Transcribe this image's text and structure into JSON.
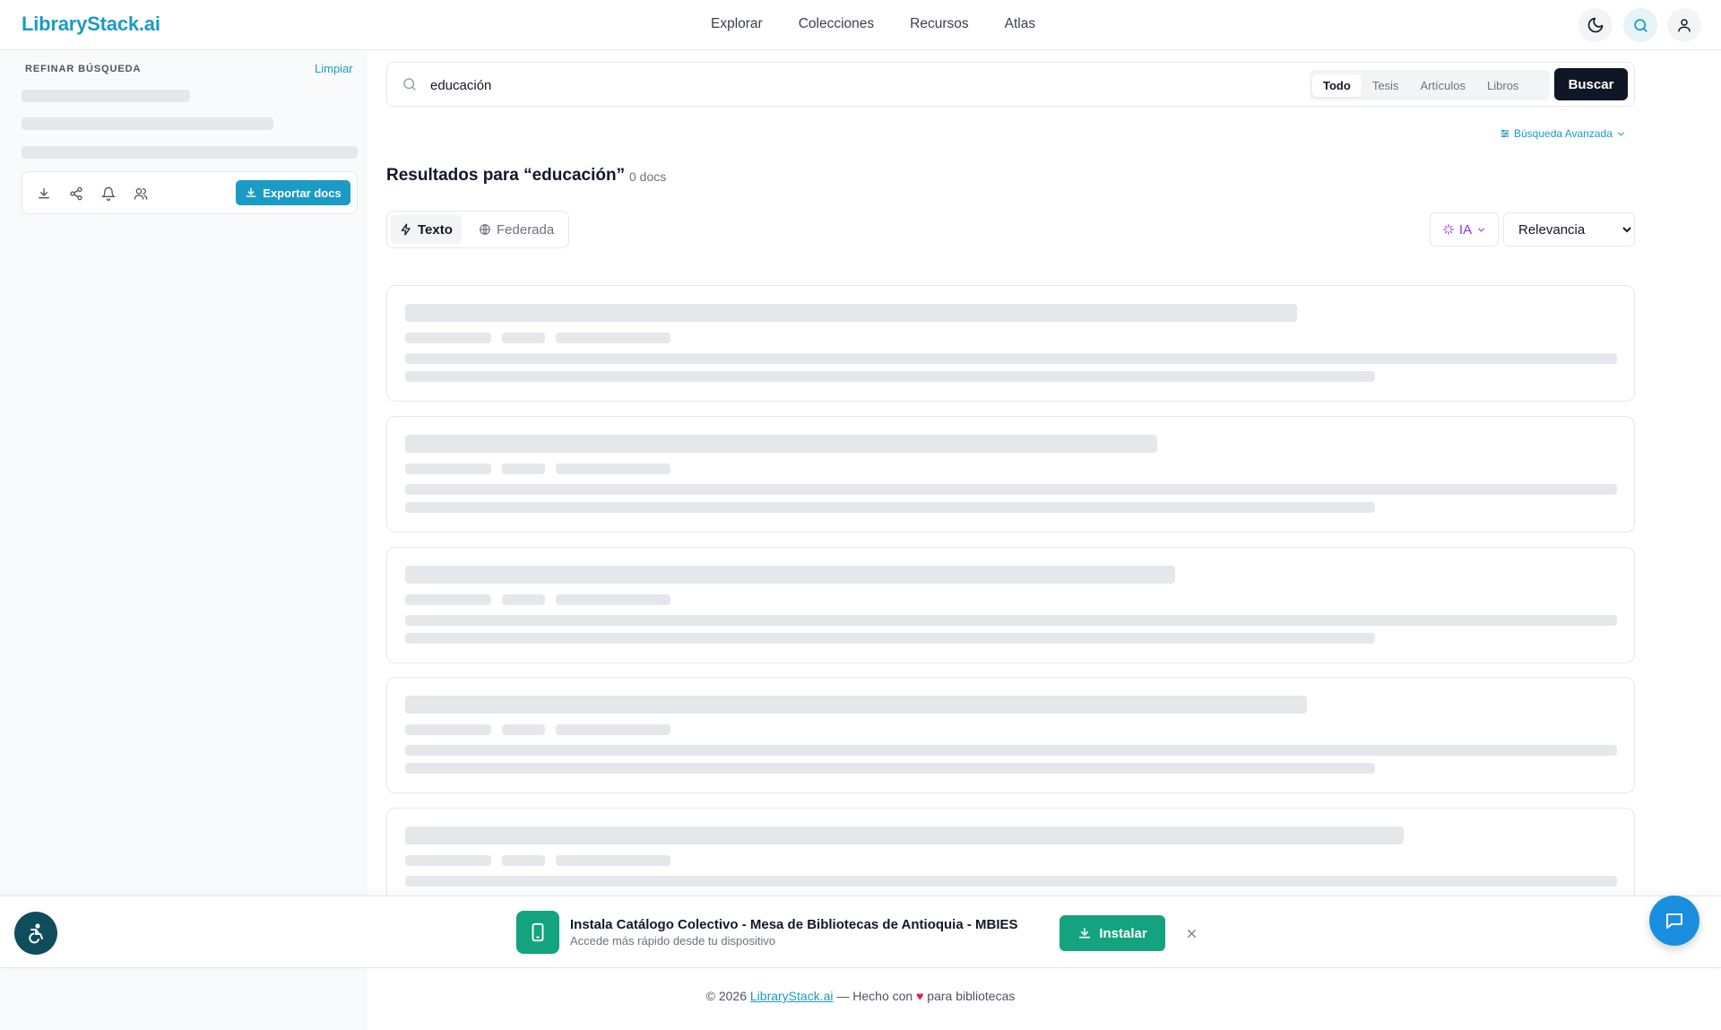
{
  "header": {
    "logo": "LibraryStack.ai",
    "nav": [
      "Explorar",
      "Colecciones",
      "Recursos",
      "Atlas"
    ]
  },
  "sidebar": {
    "title": "REFINAR BÚSQUEDA",
    "clear": "Limpiar",
    "export_label": "Exportar docs"
  },
  "search": {
    "query": "educación",
    "filters": [
      "Todo",
      "Tesis",
      "Artículos",
      "Libros"
    ],
    "active_filter": "Todo",
    "submit": "Buscar",
    "advanced": "Búsqueda Avanzada"
  },
  "results": {
    "title": "Resultados para “educación”",
    "count": "0 docs",
    "modes": [
      "Texto",
      "Federada"
    ],
    "ia_label": "IA",
    "sort_options": [
      "Relevancia"
    ],
    "sort_selected": "Relevancia"
  },
  "banner": {
    "title": "Instala Catálogo Colectivo - Mesa de Bibliotecas de Antioquia - MBIES",
    "subtitle": "Accede más rápido desde tu dispositivo",
    "install": "Instalar"
  },
  "footer": {
    "prefix": "© 2026 ",
    "link": "LibraryStack.ai",
    "middle": " — Hecho con ",
    "heart": "♥",
    "suffix": " para bibliotecas"
  },
  "colors": {
    "brand": "#1a9bc6",
    "dark_button": "#0f1626",
    "install_green": "#14a37f",
    "chat_blue": "#1a8fe0",
    "ia_purple": "#9333ea"
  }
}
